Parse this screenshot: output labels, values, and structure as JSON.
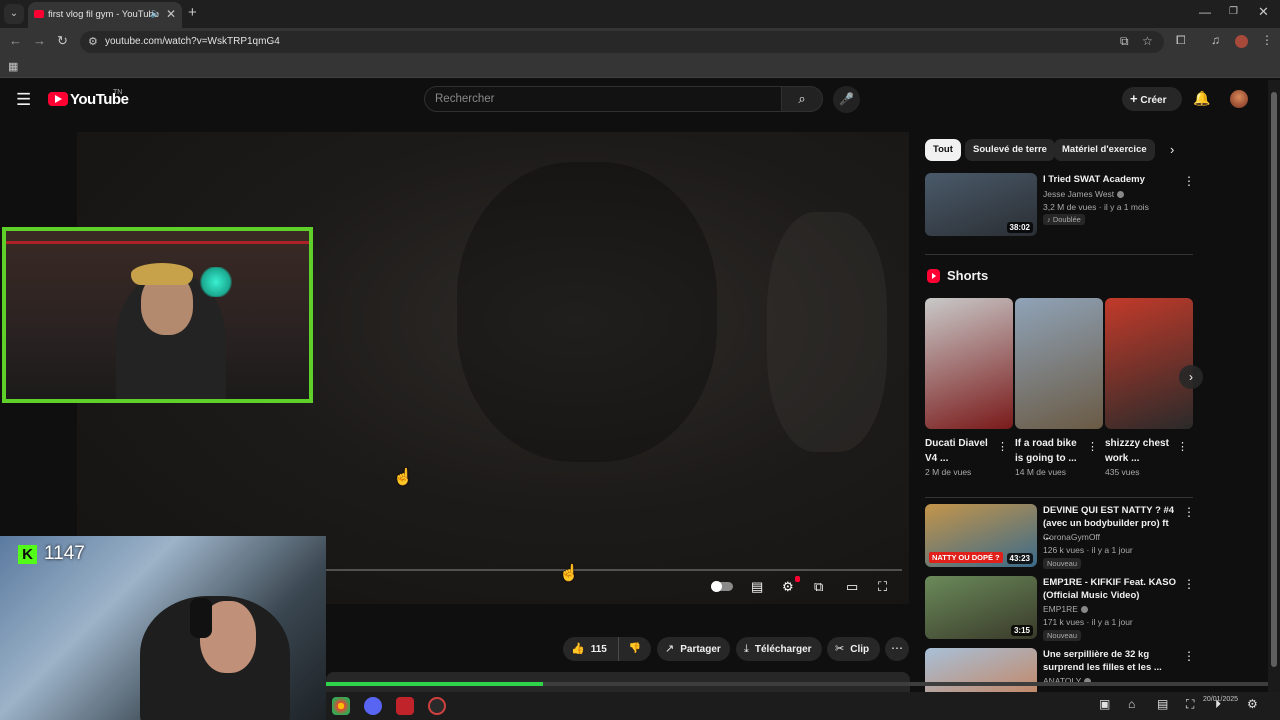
{
  "browser": {
    "tab_title": "first vlog fil gym - YouTube",
    "url": "youtube.com/watch?v=WskTRP1qmG4",
    "new_tab_symbol": "+",
    "tab_close_symbol": "✕"
  },
  "youtube": {
    "logo_text": "YouTube",
    "region": "TN",
    "search_placeholder": "Rechercher",
    "create_label": "Créer"
  },
  "player": {
    "progress_fraction": 0.29
  },
  "actions": {
    "like_count": "115",
    "share_label": "Partager",
    "download_label": "Télécharger",
    "clip_label": "Clip"
  },
  "chips": [
    "Tout",
    "Soulevé de terre",
    "Matériel d'exercice"
  ],
  "recommendations_top": [
    {
      "title": "I Tried SWAT Academy",
      "channel": "Jesse James West",
      "meta": "3,2 M de vues · il y a 1 mois",
      "badge": "Doublée",
      "duration": "38:02",
      "thumb_colors": [
        "#4a5a6a",
        "#2a2e33"
      ]
    }
  ],
  "shorts": {
    "title": "Shorts",
    "items": [
      {
        "title": "Ducati Diavel V4 ...",
        "views": "2 M de vues",
        "thumb_colors": [
          "#c9c9c9",
          "#7a1a1a"
        ]
      },
      {
        "title": "If a road bike is going to ...",
        "views": "14 M de vues",
        "thumb_colors": [
          "#8fa3b8",
          "#6a5a44"
        ]
      },
      {
        "title": "shizzzy chest work ...",
        "views": "435 vues",
        "thumb_colors": [
          "#c23a2a",
          "#2a2a2a"
        ]
      }
    ]
  },
  "recommendations": [
    {
      "title_line1": "DEVINE QUI EST NATTY ? #4",
      "title_line2": "(avec un bodybuilder pro) ft ...",
      "channel": "CoronaGymOff",
      "meta": "126 k vues · il y a 1 jour",
      "badge": "Nouveau",
      "duration": "43:23",
      "thumb_label": "NATTY OU DOPÉ ?",
      "thumb_colors": [
        "#c4954a",
        "#3a6a8a"
      ]
    },
    {
      "title_line1": "EMP1RE - KIFKIF Feat. KASO",
      "title_line2": "(Official Music Video)",
      "channel": "EMP1RE",
      "meta": "171 k vues · il y a 1 jour",
      "badge": "Nouveau",
      "duration": "3:15",
      "thumb_colors": [
        "#6a8a5a",
        "#3a3a2a"
      ]
    },
    {
      "title_line1": "Une serpillière de 32 kg",
      "title_line2": "surprend les filles et les ...",
      "channel": "ANATOLY",
      "thumb_colors": [
        "#a8c0d8",
        "#c2896a"
      ]
    }
  ],
  "stream": {
    "viewer_count": "1147",
    "kick_letter": "K",
    "watch_progress_fraction": 0.23
  },
  "taskbar": {
    "clock_date": "20/01/2025"
  },
  "colors": {
    "youtube_red": "#ff0033",
    "kick_green": "#53fc18",
    "webcam_border": "#5fd02a"
  }
}
